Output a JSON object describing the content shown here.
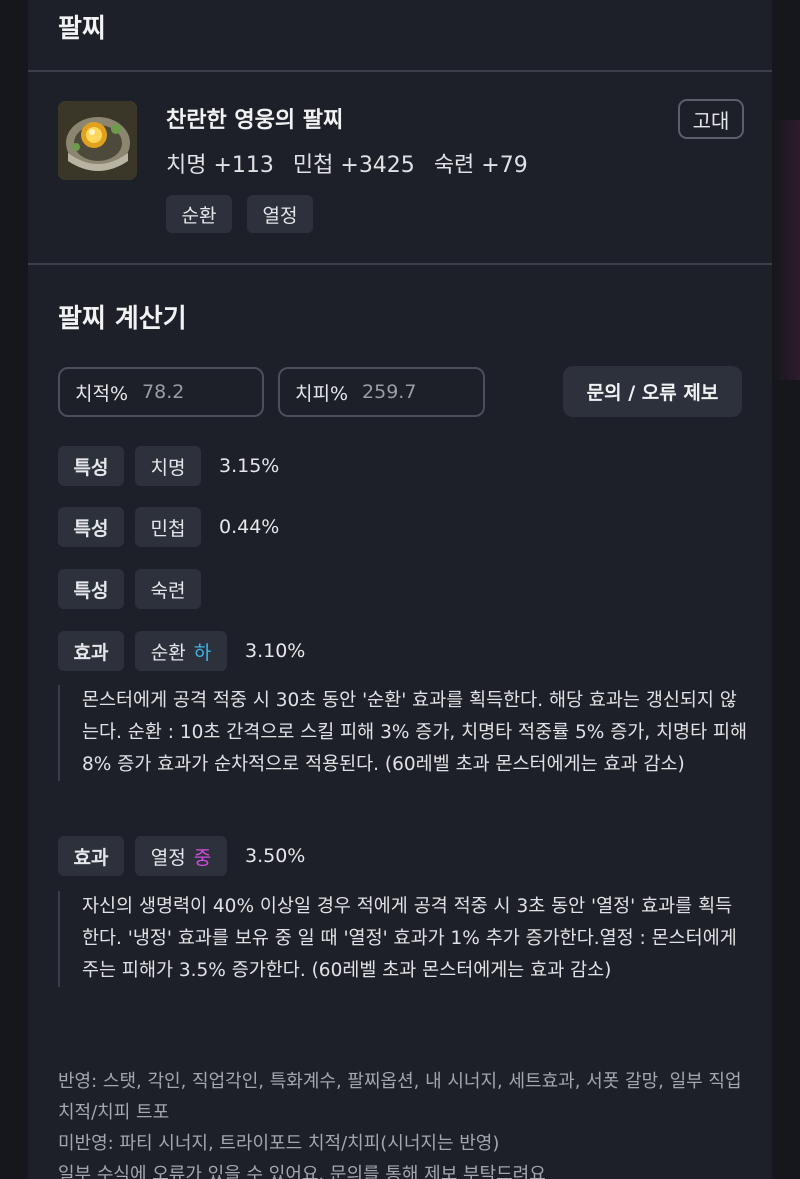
{
  "bracelet_section": {
    "title": "팔찌",
    "item": {
      "name": "찬란한 영웅의 팔찌",
      "grade": "고대",
      "stats": [
        "치명 +113",
        "민첩 +3425",
        "숙련 +79"
      ],
      "tags": [
        "순환",
        "열정"
      ]
    }
  },
  "calculator": {
    "title": "팔찌 계산기",
    "crit_rate": {
      "label": "치적%",
      "value": "78.2"
    },
    "crit_damage": {
      "label": "치피%",
      "value": "259.7"
    },
    "report_button": "문의 / 오류 제보",
    "rows": [
      {
        "kind": "특성",
        "name": "치명",
        "value": "3.15%"
      },
      {
        "kind": "특성",
        "name": "민첩",
        "value": "0.44%"
      },
      {
        "kind": "특성",
        "name": "숙련",
        "value": ""
      },
      {
        "kind": "효과",
        "name": "순환",
        "level": "하",
        "value": "3.10%",
        "description": "몬스터에게 공격 적중 시 30초 동안 '순환' 효과를 획득한다. 해당 효과는 갱신되지 않는다. 순환 : 10초 간격으로 스킬 피해 3% 증가, 치명타 적중률 5% 증가, 치명타 피해 8% 증가 효과가 순차적으로 적용된다. (60레벨 초과 몬스터에게는 효과 감소)"
      },
      {
        "kind": "효과",
        "name": "열정",
        "level": "중",
        "value": "3.50%",
        "description": "자신의 생명력이 40% 이상일 경우 적에게 공격 적중 시 3초 동안 '열정' 효과를 획득한다. '냉정' 효과를 보유 중 일 때 '열정' 효과가 1% 추가 증가한다.열정 : 몬스터에게 주는 피해가 3.5% 증가한다. (60레벨 초과 몬스터에게는 효과 감소)"
      }
    ],
    "notes": [
      "반영: 스탯, 각인, 직업각인, 특화계수, 팔찌옵션, 내 시너지, 세트효과, 서폿 갈망, 일부 직업 치적/치피 트포",
      "미반영: 파티 시너지, 트라이포드 치적/치피(시너지는 반영)",
      "일부 수식에 오류가 있을 수 있어요. 문의를 통해 제보 부탁드려요"
    ]
  },
  "colors": {
    "level_low": "#3fb4e8",
    "level_mid": "#d34ce0",
    "panel_bg": "#1d2028",
    "chip_bg": "#2c313c"
  }
}
